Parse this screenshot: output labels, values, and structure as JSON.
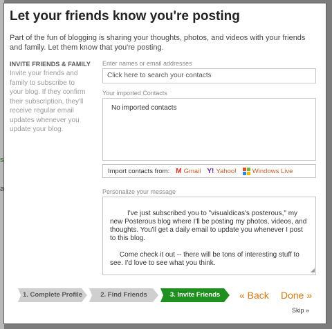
{
  "dialog": {
    "title": "Let your friends know you're posting",
    "intro": "Part of the fun of blogging is sharing your thoughts, photos, and videos with your friends and family. Let them know that you're posting."
  },
  "invite_section": {
    "heading": "INVITE FRIENDS & FAMILY",
    "description": "Invite your friends and family to subscribe to your blog. If they confirm their subscription, they'll receive regular email updates whenever you update your blog."
  },
  "search": {
    "label": "Enter names or email addresses",
    "placeholder": "Click here to search your contacts"
  },
  "imported": {
    "label": "Your imported Contacts",
    "empty_text": "No imported contacts"
  },
  "import": {
    "label": "Import contacts from:",
    "providers": [
      {
        "name": "Gmail",
        "icon": "gmail-icon"
      },
      {
        "name": "Yahoo!",
        "icon": "yahoo-icon"
      },
      {
        "name": "Windows Live",
        "icon": "windows-live-icon"
      }
    ]
  },
  "message": {
    "label": "Personalize your message",
    "value": "     I've just subscribed you to \"visualdicas's posterous,\" my new Posterous blog where I'll be posting my photos, videos, and thoughts. You'll get a daily email to update you whenever I post to this blog.\n\n     Come check it out -- there will be tons of interesting stuff to see. I'd love to see what you think.\n\n     Yours,\n     visualdicas"
  },
  "steps": [
    {
      "label": "1. Complete Profile",
      "state": "done"
    },
    {
      "label": "2. Find Friends",
      "state": "done"
    },
    {
      "label": "3. Invite Friends",
      "state": "active"
    }
  ],
  "nav": {
    "back": "« Back",
    "done": "Done »",
    "skip": "Skip »"
  },
  "background": {
    "fragments": [
      "s",
      "a"
    ]
  },
  "colors": {
    "accent_orange": "#d07a10",
    "active_step": "#1f8f1f",
    "inactive_step": "#cfcfcf"
  }
}
